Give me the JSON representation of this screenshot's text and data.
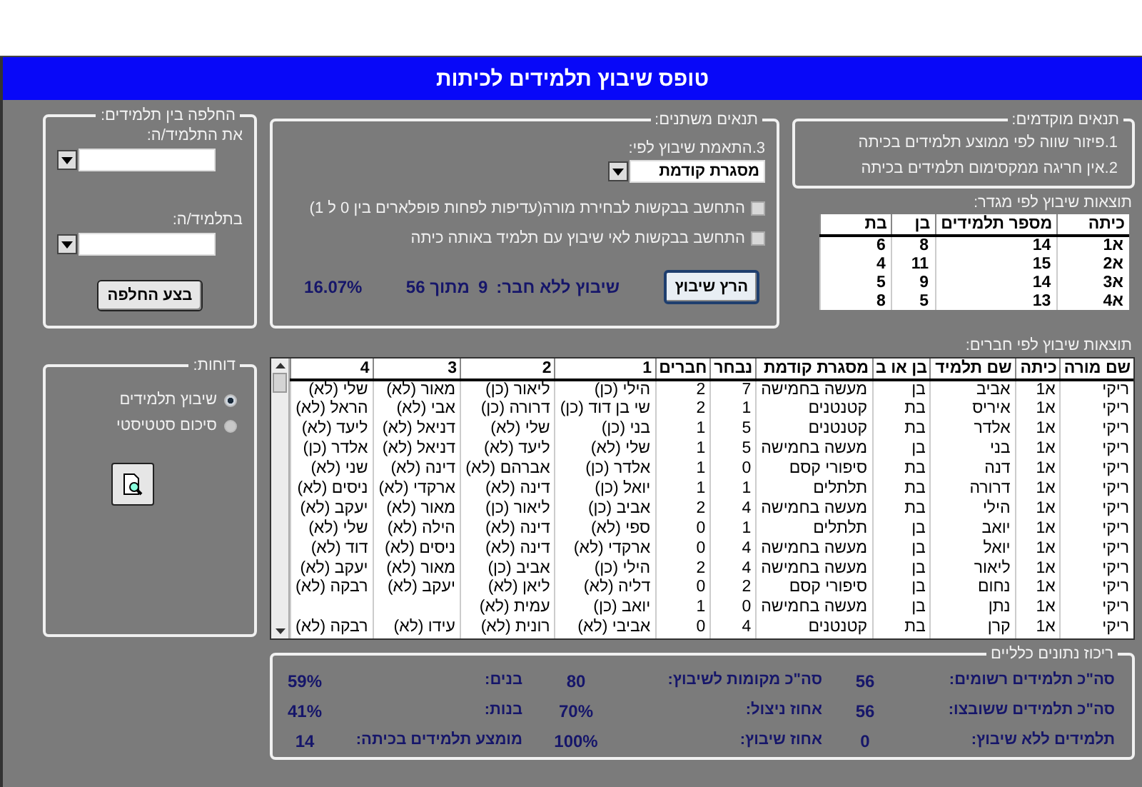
{
  "window": {
    "title": "טופס שיבוץ תלמידים לכיתות"
  },
  "swap_panel": {
    "legend": "החלפה בין תלמידים:",
    "from_label": "את התלמיד/ה:",
    "to_label": "בתלמיד/ה:",
    "button": "בצע החלפה"
  },
  "variable_conditions": {
    "legend": "תנאים משתנים:",
    "match_label": "3.התאמת שיבוץ לפי:",
    "match_value": "מסגרת קודמת",
    "checks": [
      {
        "label": "התחשב בבקשות לבחירת מורה(עדיפות לפחות פופלארים בין 0 ל 1)",
        "checked": false
      },
      {
        "label": "התחשב בבקשות לאי שיבוץ עם תלמיד באותה כיתה",
        "checked": false
      }
    ],
    "run_button": "הרץ שיבוץ",
    "unmatched_label": "שיבוץ ללא חבר:",
    "unmatched_count": "9",
    "unmatched_total": "מתוך 56",
    "unmatched_percent": "16.07%"
  },
  "preconditions": {
    "legend": "תנאים מוקדמים:",
    "items": [
      "1.פיזור שווה לפי ממוצע תלמידים בכיתה",
      "2.אין חריגה ממקסימום תלמידים בכיתה"
    ]
  },
  "gender_results": {
    "title": "תוצאות שיבוץ לפי מגדר:",
    "columns": [
      "כיתה",
      "מספר תלמידים",
      "בן",
      "בת"
    ],
    "rows": [
      [
        "א1",
        "14",
        "8",
        "6"
      ],
      [
        "א2",
        "15",
        "11",
        "4"
      ],
      [
        "א3",
        "14",
        "9",
        "5"
      ],
      [
        "א4",
        "13",
        "5",
        "8"
      ]
    ]
  },
  "reports": {
    "legend": "דוחות:",
    "options": [
      {
        "label": "שיבוץ תלמידים",
        "selected": true
      },
      {
        "label": "סיכום סטטיסטי",
        "selected": false
      }
    ]
  },
  "friend_results": {
    "title": "תוצאות שיבוץ לפי חברים:",
    "columns": [
      "שם מורה",
      "כיתה",
      "שם תלמיד",
      "בן או ב",
      "מסגרת קודמת",
      "נבחר",
      "חברים",
      "1",
      "2",
      "3",
      "4"
    ],
    "rows": [
      [
        "ריקי",
        "א1",
        "אביב",
        "בן",
        "מעשה בחמישה",
        "7",
        "2",
        "הילי (כן)",
        "ליאור (כן)",
        "מאור (לא)",
        "שלי (לא)"
      ],
      [
        "ריקי",
        "א1",
        "איריס",
        "בת",
        "קטנטנים",
        "1",
        "2",
        "שי בן דוד (כן)",
        "דרורה (כן)",
        "אבי (לא)",
        "הראל (לא)"
      ],
      [
        "ריקי",
        "א1",
        "אלדר",
        "בת",
        "קטנטנים",
        "5",
        "1",
        "בני (כן)",
        "שלי (לא)",
        "דניאל (לא)",
        "ליעד (לא)"
      ],
      [
        "ריקי",
        "א1",
        "בני",
        "בן",
        "מעשה בחמישה",
        "5",
        "1",
        "שלי (לא)",
        "ליעד (לא)",
        "דניאל (לא)",
        "אלדר (כן)"
      ],
      [
        "ריקי",
        "א1",
        "דנה",
        "בת",
        "סיפורי קסם",
        "0",
        "1",
        "אלדר (כן)",
        "אברהם (לא)",
        "דינה (לא)",
        "שני (לא)"
      ],
      [
        "ריקי",
        "א1",
        "דרורה",
        "בת",
        "תלתלים",
        "1",
        "1",
        "יואל (כן)",
        "דינה (לא)",
        "ארקדי (לא)",
        "ניסים (לא)"
      ],
      [
        "ריקי",
        "א1",
        "הילי",
        "בת",
        "מעשה בחמישה",
        "4",
        "2",
        "אביב (כן)",
        "ליאור (כן)",
        "מאור (לא)",
        "יעקב (לא)"
      ],
      [
        "ריקי",
        "א1",
        "יואב",
        "בן",
        "תלתלים",
        "1",
        "0",
        "ספי (לא)",
        "דינה (לא)",
        "הילה (לא)",
        "שלי (לא)"
      ],
      [
        "ריקי",
        "א1",
        "יואל",
        "בן",
        "מעשה בחמישה",
        "4",
        "0",
        "ארקדי (לא)",
        "דינה (לא)",
        "ניסים (לא)",
        "דוד (לא)"
      ],
      [
        "ריקי",
        "א1",
        "ליאור",
        "בן",
        "מעשה בחמישה",
        "4",
        "2",
        "הילי (כן)",
        "אביב (כן)",
        "מאור (לא)",
        "יעקב (לא)"
      ],
      [
        "ריקי",
        "א1",
        "נחום",
        "בן",
        "סיפורי קסם",
        "2",
        "0",
        "דליה (לא)",
        "ליאן (לא)",
        "יעקב (לא)",
        "רבקה (לא)"
      ],
      [
        "ריקי",
        "א1",
        "נתן",
        "בן",
        "מעשה בחמישה",
        "0",
        "1",
        "יואב (כן)",
        "עמית (לא)"
      ],
      [
        "ריקי",
        "א1",
        "קרן",
        "בת",
        "קטנטנים",
        "4",
        "0",
        "אביבי (לא)",
        "רונית (לא)",
        "עידו (לא)",
        "רבקה (לא)"
      ]
    ]
  },
  "summary": {
    "legend": "ריכוז נתונים כלליים",
    "items": [
      {
        "label": "סה\"כ תלמידים רשומים:",
        "value": "56"
      },
      {
        "label": "סה\"כ מקומות לשיבוץ:",
        "value": "80"
      },
      {
        "label": "בנים:",
        "value": "59%"
      },
      {
        "label": "סה\"כ תלמידים ששובצו:",
        "value": "56"
      },
      {
        "label": "אחוז ניצול:",
        "value": "70%"
      },
      {
        "label": "בנות:",
        "value": "41%"
      },
      {
        "label": "תלמידים ללא שיבוץ:",
        "value": "0"
      },
      {
        "label": "אחוז שיבוץ:",
        "value": "100%"
      },
      {
        "label": "מומצע תלמידים בכיתה:",
        "value": "14"
      }
    ]
  }
}
